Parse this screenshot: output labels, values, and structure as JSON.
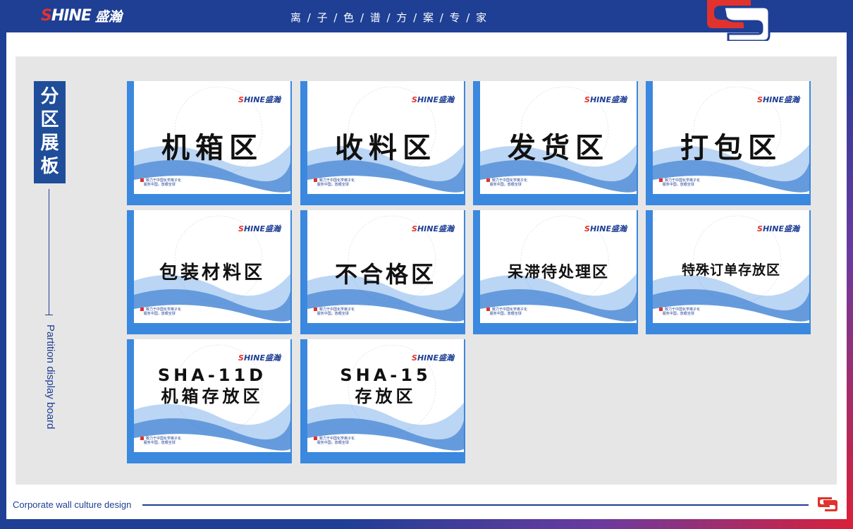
{
  "header": {
    "logo_en_s": "S",
    "logo_en_rest": "HINE",
    "logo_cn": "盛瀚",
    "slogan": "离 / 子 / 色 / 谱 / 方 / 案 / 专 / 家"
  },
  "sidebar": {
    "title": "分区展板",
    "subtitle": "Partition display board"
  },
  "signs": [
    {
      "label": "机箱区",
      "brand_s": "S",
      "brand_rest": "HINE盛瀚",
      "foot1": "致力于中国化学离子化",
      "foot2": "服务中国，放眼全球"
    },
    {
      "label": "收料区",
      "brand_s": "S",
      "brand_rest": "HINE盛瀚",
      "foot1": "致力于中国化学离子化",
      "foot2": "服务中国，放眼全球"
    },
    {
      "label": "发货区",
      "brand_s": "S",
      "brand_rest": "HINE盛瀚",
      "foot1": "致力于中国化学离子化",
      "foot2": "服务中国，放眼全球"
    },
    {
      "label": "打包区",
      "brand_s": "S",
      "brand_rest": "HINE盛瀚",
      "foot1": "致力于中国化学离子化",
      "foot2": "服务中国，放眼全球"
    },
    {
      "label": "包装材料区",
      "brand_s": "S",
      "brand_rest": "HINE盛瀚",
      "foot1": "致力于中国化学离子化",
      "foot2": "服务中国，放眼全球"
    },
    {
      "label": "不合格区",
      "brand_s": "S",
      "brand_rest": "HINE盛瀚",
      "foot1": "致力于中国化学离子化",
      "foot2": "服务中国，放眼全球"
    },
    {
      "label": "呆滞待处理区",
      "brand_s": "S",
      "brand_rest": "HINE盛瀚",
      "foot1": "致力于中国化学离子化",
      "foot2": "服务中国，放眼全球"
    },
    {
      "label": "特殊订单存放区",
      "brand_s": "S",
      "brand_rest": "HINE盛瀚",
      "foot1": "致力于中国化学离子化",
      "foot2": "服务中国，放眼全球"
    },
    {
      "label": "SHA-11D\n机箱存放区",
      "brand_s": "S",
      "brand_rest": "HINE盛瀚",
      "foot1": "致力于中国化学离子化",
      "foot2": "服务中国，放眼全球"
    },
    {
      "label": "SHA-15\n存放区",
      "brand_s": "S",
      "brand_rest": "HINE盛瀚",
      "foot1": "致力于中国化学离子化",
      "foot2": "服务中国，放眼全球"
    }
  ],
  "footer": {
    "text": "Corporate wall culture design"
  },
  "colors": {
    "brand_blue": "#1f3f95",
    "brand_red": "#e1322d",
    "sign_blue": "#3b88df",
    "panel_grey": "#e6e6e6"
  }
}
